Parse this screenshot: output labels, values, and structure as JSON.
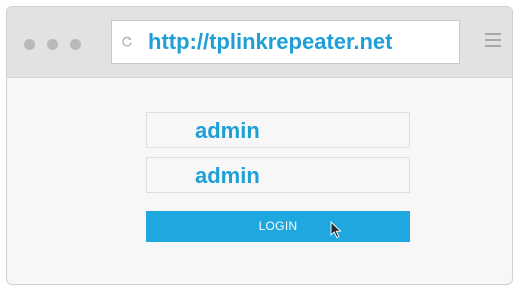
{
  "browser": {
    "url": "http://tplinkrepeater.net",
    "icons": {
      "window_controls": [
        "dot-icon",
        "dot-icon",
        "dot-icon"
      ],
      "reload": "refresh-icon",
      "menu": "hamburger-menu-icon"
    }
  },
  "login_form": {
    "username_value": "admin",
    "password_value": "admin",
    "login_label": "LOGIN"
  },
  "colors": {
    "accent": "#1e9fd6",
    "button": "#1fa7e0",
    "chrome": "#e2e2e2"
  }
}
